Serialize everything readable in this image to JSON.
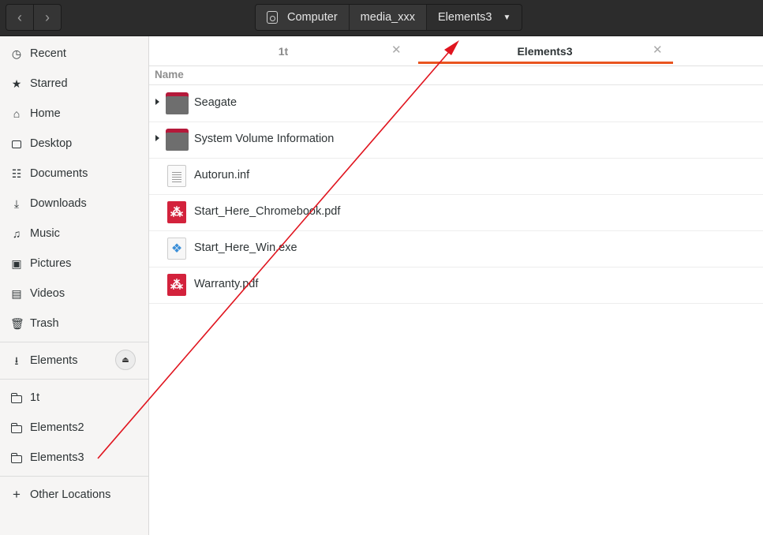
{
  "header": {
    "back_icon": "chevron-left-icon",
    "forward_icon": "chevron-right-icon",
    "breadcrumbs": [
      "Computer",
      "media_xxx",
      "Elements3"
    ]
  },
  "sidebar": {
    "places": [
      {
        "label": "Recent",
        "icon": "clock-icon"
      },
      {
        "label": "Starred",
        "icon": "star-icon"
      },
      {
        "label": "Home",
        "icon": "home-icon"
      },
      {
        "label": "Desktop",
        "icon": "desktop-icon"
      },
      {
        "label": "Documents",
        "icon": "document-icon"
      },
      {
        "label": "Downloads",
        "icon": "download-icon"
      },
      {
        "label": "Music",
        "icon": "music-icon"
      },
      {
        "label": "Pictures",
        "icon": "picture-icon"
      },
      {
        "label": "Videos",
        "icon": "video-icon"
      },
      {
        "label": "Trash",
        "icon": "trash-icon"
      }
    ],
    "devices": [
      {
        "label": "Elements",
        "icon": "usb-icon"
      }
    ],
    "bookmarks": [
      {
        "label": "1t",
        "icon": "folder-icon"
      },
      {
        "label": "Elements2",
        "icon": "folder-icon"
      },
      {
        "label": "Elements3",
        "icon": "folder-icon"
      }
    ],
    "other": {
      "label": "Other Locations",
      "icon": "plus-icon"
    }
  },
  "tabs": [
    {
      "label": "1t",
      "active": false
    },
    {
      "label": "Elements3",
      "active": true
    }
  ],
  "list": {
    "column_name": "Name",
    "files": [
      {
        "name": "Seagate",
        "type": "folder"
      },
      {
        "name": "System Volume Information",
        "type": "folder"
      },
      {
        "name": "Autorun.inf",
        "type": "text"
      },
      {
        "name": "Start_Here_Chromebook.pdf",
        "type": "pdf"
      },
      {
        "name": "Start_Here_Win.exe",
        "type": "exe"
      },
      {
        "name": "Warranty.pdf",
        "type": "pdf"
      }
    ]
  },
  "colors": {
    "accent": "#e95420",
    "annotation_arrow": "#e0141e",
    "folder_tab": "#b5193a",
    "pdf": "#d3223c"
  }
}
